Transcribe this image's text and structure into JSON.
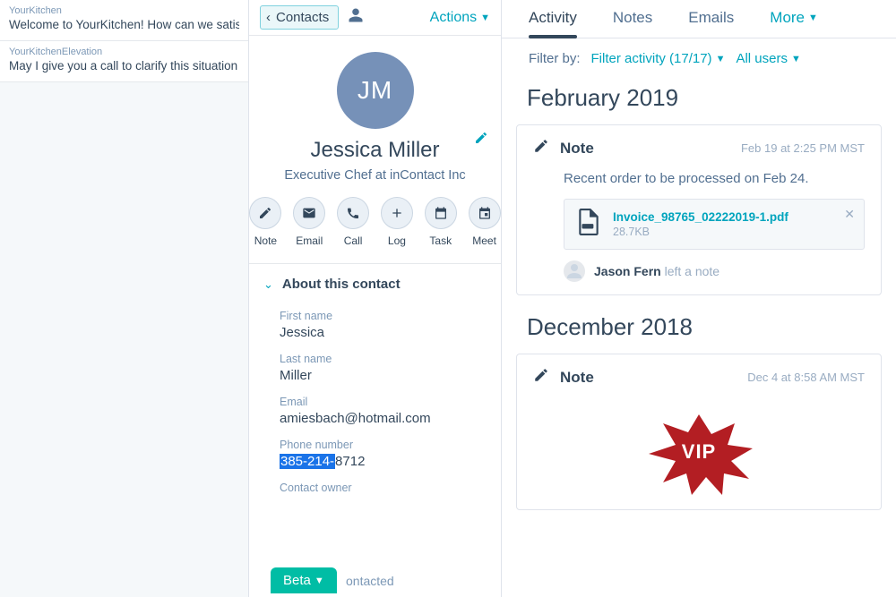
{
  "col1": {
    "items": [
      {
        "from": "YourKitchen",
        "snippet": "Welcome to YourKitchen! How can we satis"
      },
      {
        "from": "YourKitchenElevation",
        "snippet": "May I give you a call to clarify this situation"
      }
    ]
  },
  "col2": {
    "back_label": "Contacts",
    "actions_label": "Actions",
    "avatar_initials": "JM",
    "name": "Jessica Miller",
    "title_line": "Executive Chef at inContact Inc",
    "action_buttons": [
      {
        "label": "Note"
      },
      {
        "label": "Email"
      },
      {
        "label": "Call"
      },
      {
        "label": "Log"
      },
      {
        "label": "Task"
      },
      {
        "label": "Meet"
      }
    ],
    "section_title": "About this contact",
    "fields": {
      "first_name": {
        "label": "First name",
        "value": "Jessica"
      },
      "last_name": {
        "label": "Last name",
        "value": "Miller"
      },
      "email": {
        "label": "Email",
        "value": "amiesbach@hotmail.com"
      },
      "phone": {
        "label": "Phone number",
        "value_prefix": "385-214-",
        "value_suffix": "8712"
      },
      "owner": {
        "label": "Contact owner",
        "value": "ontacted"
      }
    },
    "beta_label": "Beta"
  },
  "col3": {
    "tabs": {
      "activity": "Activity",
      "notes": "Notes",
      "emails": "Emails",
      "more": "More"
    },
    "filter": {
      "label": "Filter by:",
      "activity": "Filter activity (17/17)",
      "users": "All users"
    },
    "months": {
      "feb": {
        "heading": "February 2019",
        "card": {
          "kind": "Note",
          "time": "Feb 19 at 2:25 PM MST",
          "body": "Recent order to be processed on Feb 24.",
          "attachment": {
            "name": "Invoice_98765_02222019-1.pdf",
            "size": "28.7KB"
          },
          "byline_name": "Jason Fern",
          "byline_tail": "left a note"
        }
      },
      "dec": {
        "heading": "December 2018",
        "card": {
          "kind": "Note",
          "time": "Dec 4 at 8:58 AM MST",
          "vip": "VIP"
        }
      }
    }
  }
}
